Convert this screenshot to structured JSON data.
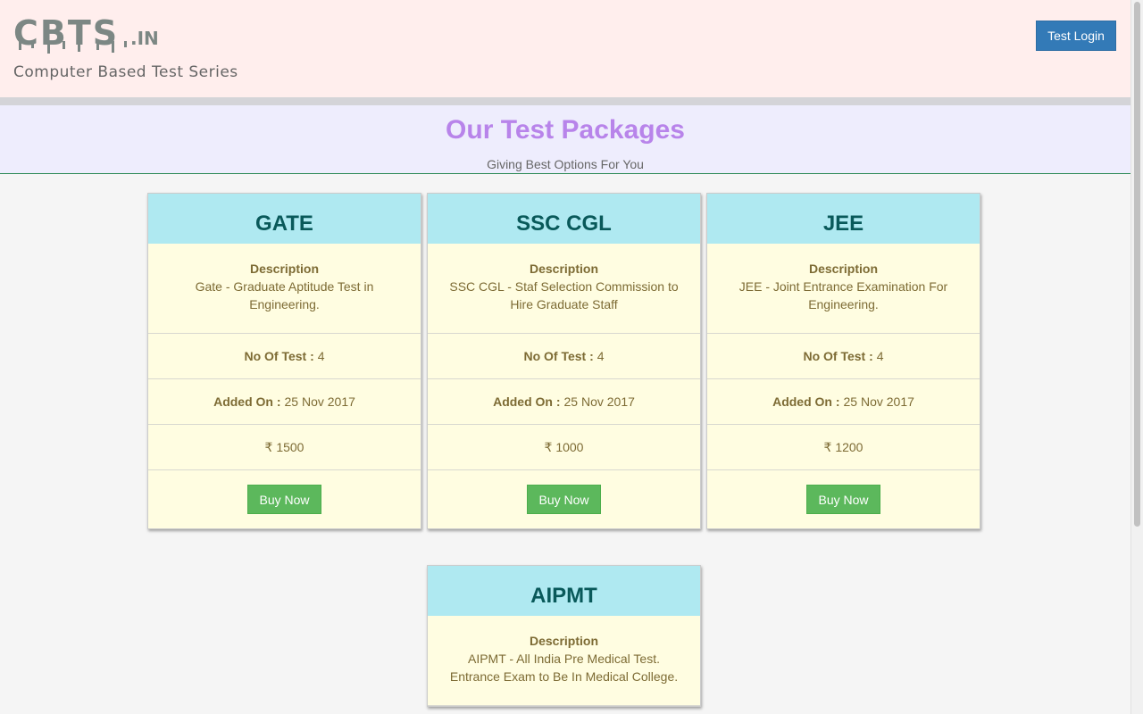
{
  "header": {
    "logo_text": "CBTS",
    "logo_suffix": ".IN",
    "tagline": "Computer Based Test Series",
    "login_label": "Test Login"
  },
  "banner": {
    "title": "Our Test Packages",
    "subtitle": "Giving Best Options For You"
  },
  "labels": {
    "description": "Description",
    "no_of_test": "No Of Test :",
    "added_on": "Added On :",
    "buy": "Buy Now",
    "currency": "₹"
  },
  "packages": [
    {
      "name": "GATE",
      "description": "Gate - Graduate Aptitude Test in Engineering.",
      "tests": "4",
      "added": "25 Nov 2017",
      "price": "₹ 1500"
    },
    {
      "name": "SSC CGL",
      "description": "SSC CGL - Staf Selection Commission to Hire Graduate Staff",
      "tests": "4",
      "added": "25 Nov 2017",
      "price": "₹ 1000"
    },
    {
      "name": "JEE",
      "description": "JEE - Joint Entrance Examination For Engineering.",
      "tests": "4",
      "added": "25 Nov 2017",
      "price": "₹ 1200"
    },
    {
      "name": "AIPMT",
      "description": "AIPMT - All India Pre Medical Test. Entrance Exam to Be In Medical College.",
      "tests": "",
      "added": "",
      "price": ""
    }
  ],
  "colors": {
    "header_bg": "#ffeeed",
    "banner_bg": "#eeedfd",
    "title": "#b884ea",
    "card_head": "#afe9f1",
    "card_body": "#fffde1",
    "login_btn": "#337ab7",
    "buy_btn": "#5cb85c"
  }
}
